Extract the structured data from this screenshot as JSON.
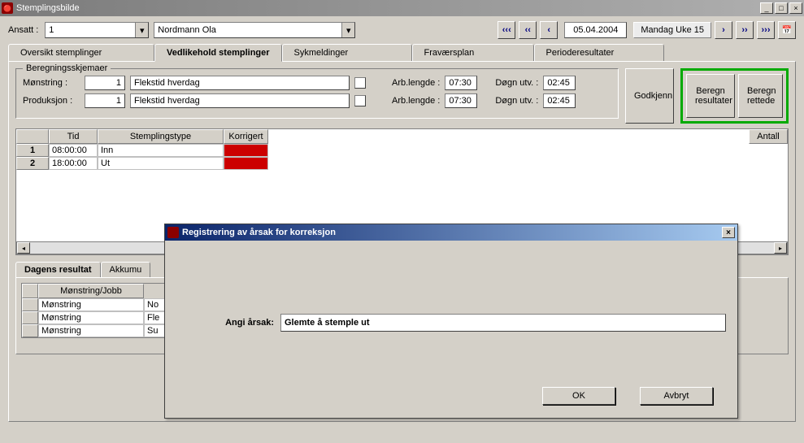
{
  "window": {
    "title": "Stemplingsbilde",
    "min": "_",
    "max": "□",
    "close": "×"
  },
  "toolbar": {
    "ansatt_label": "Ansatt :",
    "ansatt_id": "1",
    "ansatt_name": "Nordmann Ola",
    "nav_first": "«",
    "nav_prev2": "«",
    "nav_prev": "‹",
    "date": "05.04.2004",
    "week": "Mandag Uke 15",
    "nav_next": "›",
    "nav_next2": "»",
    "nav_last": "»",
    "calendar_icon": "🗓"
  },
  "tabs": [
    {
      "label": "Oversikt stemplinger"
    },
    {
      "label": "Vedlikehold stemplinger",
      "active": true
    },
    {
      "label": "Sykmeldinger"
    },
    {
      "label": "Fraværsplan"
    },
    {
      "label": "Perioderesultater"
    }
  ],
  "calc": {
    "legend": "Beregningsskjemaer",
    "rows": [
      {
        "label": "Mønstring :",
        "num": "1",
        "name": "Flekstid hverdag",
        "arb_label": "Arb.lengde :",
        "arb": "07:30",
        "dogn_label": "Døgn utv. :",
        "dogn": "02:45"
      },
      {
        "label": "Produksjon :",
        "num": "1",
        "name": "Flekstid hverdag",
        "arb_label": "Arb.lengde :",
        "arb": "07:30",
        "dogn_label": "Døgn utv. :",
        "dogn": "02:45"
      }
    ],
    "godkjenn": "Godkjenn",
    "beregn_res": "Beregn\nresultater",
    "beregn_ret": "Beregn\nrettede"
  },
  "grid": {
    "headers": {
      "tid": "Tid",
      "type": "Stemplingstype",
      "korr": "Korrigert",
      "antall": "Antall"
    },
    "rows": [
      {
        "n": "1",
        "tid": "08:00:00",
        "type": "Inn"
      },
      {
        "n": "2",
        "tid": "18:00:00",
        "type": "Ut"
      }
    ]
  },
  "subtabs": [
    {
      "label": "Dagens resultat",
      "active": true
    },
    {
      "label": "Akkumu"
    }
  ],
  "result_grid": {
    "header": "Mønstring/Jobb",
    "rows": [
      {
        "a": "Mønstring",
        "b": "No"
      },
      {
        "a": "Mønstring",
        "b": "Fle"
      },
      {
        "a": "Mønstring",
        "b": "Su"
      }
    ]
  },
  "modal": {
    "title": "Registrering av årsak for korreksjon",
    "field_label": "Angi årsak:",
    "field_value": "Glemte å stemple ut",
    "ok": "OK",
    "cancel": "Avbryt",
    "close": "×"
  }
}
